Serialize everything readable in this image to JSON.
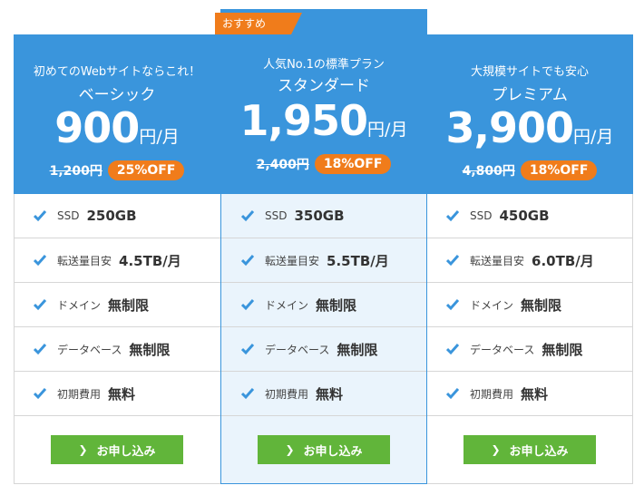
{
  "badge": "おすすめ",
  "plans": [
    {
      "tagline": "初めてのWebサイトならこれ！",
      "name": "ベーシック",
      "price": "900",
      "unit": "円/月",
      "old_price": "1,200円",
      "discount": "25%OFF",
      "features": [
        {
          "label": "SSD",
          "value": "250GB"
        },
        {
          "label": "転送量目安",
          "value": "4.5TB/月"
        },
        {
          "label": "ドメイン",
          "value": "無制限"
        },
        {
          "label": "データベース",
          "value": "無制限"
        },
        {
          "label": "初期費用",
          "value": "無料"
        }
      ],
      "button": "お申し込み"
    },
    {
      "tagline": "人気No.1の標準プラン",
      "name": "スタンダード",
      "price": "1,950",
      "unit": "円/月",
      "old_price": "2,400円",
      "discount": "18%OFF",
      "features": [
        {
          "label": "SSD",
          "value": "350GB"
        },
        {
          "label": "転送量目安",
          "value": "5.5TB/月"
        },
        {
          "label": "ドメイン",
          "value": "無制限"
        },
        {
          "label": "データベース",
          "value": "無制限"
        },
        {
          "label": "初期費用",
          "value": "無料"
        }
      ],
      "button": "お申し込み"
    },
    {
      "tagline": "大規模サイトでも安心",
      "name": "プレミアム",
      "price": "3,900",
      "unit": "円/月",
      "old_price": "4,800円",
      "discount": "18%OFF",
      "features": [
        {
          "label": "SSD",
          "value": "450GB"
        },
        {
          "label": "転送量目安",
          "value": "6.0TB/月"
        },
        {
          "label": "ドメイン",
          "value": "無制限"
        },
        {
          "label": "データベース",
          "value": "無制限"
        },
        {
          "label": "初期費用",
          "value": "無料"
        }
      ],
      "button": "お申し込み"
    }
  ],
  "colors": {
    "header": "#3a95dc",
    "discount": "#f07c1b",
    "button": "#61b53a",
    "featured_bg": "#eaf4fc",
    "check": "#3a95dc"
  }
}
